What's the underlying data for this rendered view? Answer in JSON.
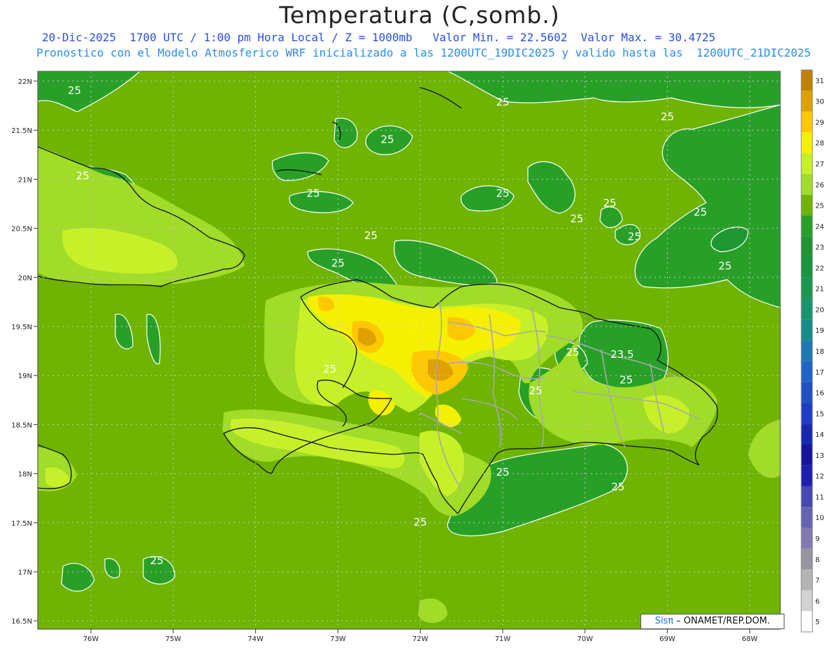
{
  "header": {
    "title": "Temperatura (C,somb.)",
    "line1": "20-Dic-2025  1700 UTC / 1:00 pm Hora Local / Z = 1000mb   Valor Min. = 22.5602  Valor Max. = 30.4725",
    "line2": "Pronostico con el Modelo Atmosferico WRF inicializado a las 1200UTC_19DIC2025 y valido hasta las  1200UTC_21DIC2025"
  },
  "axes": {
    "lat_labels": [
      "22N",
      "21.5N",
      "21N",
      "20.5N",
      "20N",
      "19.5N",
      "19N",
      "18.5N",
      "18N",
      "17.5N",
      "17N",
      "16.5N"
    ],
    "lon_labels": [
      "76W",
      "75W",
      "74W",
      "73W",
      "72W",
      "71W",
      "70W",
      "69W",
      "68W"
    ]
  },
  "colorbar": {
    "labels": [
      "31",
      "30",
      "29",
      "28",
      "27",
      "26",
      "25",
      "24",
      "23",
      "22",
      "21",
      "20",
      "19",
      "18",
      "17",
      "16",
      "15",
      "14",
      "13",
      "12",
      "11",
      "10",
      "9",
      "8",
      "7",
      "6",
      "5"
    ],
    "colors": [
      "#c08000",
      "#e0a000",
      "#ffc800",
      "#f5f000",
      "#c8f028",
      "#a0dc28",
      "#6eb400",
      "#28a028",
      "#1e9632",
      "#18963c",
      "#1a9650",
      "#16966e",
      "#148c8c",
      "#1e78b4",
      "#1e64c8",
      "#1e50c8",
      "#1e3cc8",
      "#1428b4",
      "#1414a0",
      "#1e1eb4",
      "#4646b4",
      "#6464b4",
      "#8278b4",
      "#9696a0",
      "#b4b4b4",
      "#d2d2d2",
      "#ffffff"
    ]
  },
  "contour_labels": [
    {
      "text": "25",
      "lon": -76.2,
      "lat": 21.87
    },
    {
      "text": "25",
      "lon": -76.1,
      "lat": 21.0
    },
    {
      "text": "25",
      "lon": -71.0,
      "lat": 21.75
    },
    {
      "text": "25",
      "lon": -69.0,
      "lat": 21.6
    },
    {
      "text": "25",
      "lon": -72.4,
      "lat": 21.37
    },
    {
      "text": "25",
      "lon": -73.3,
      "lat": 20.82
    },
    {
      "text": "25",
      "lon": -71.0,
      "lat": 20.82
    },
    {
      "text": "25",
      "lon": -69.7,
      "lat": 20.72
    },
    {
      "text": "25",
      "lon": -68.6,
      "lat": 20.63
    },
    {
      "text": "25",
      "lon": -70.1,
      "lat": 20.56
    },
    {
      "text": "25",
      "lon": -69.4,
      "lat": 20.38
    },
    {
      "text": "25",
      "lon": -72.6,
      "lat": 20.39
    },
    {
      "text": "25",
      "lon": -73.0,
      "lat": 20.11
    },
    {
      "text": "25",
      "lon": -68.3,
      "lat": 20.08
    },
    {
      "text": "25",
      "lon": -70.15,
      "lat": 19.2
    },
    {
      "text": "23.5",
      "lon": -69.55,
      "lat": 19.18
    },
    {
      "text": "25",
      "lon": -69.5,
      "lat": 18.92
    },
    {
      "text": "25",
      "lon": -73.1,
      "lat": 19.03
    },
    {
      "text": "25",
      "lon": -70.6,
      "lat": 18.81
    },
    {
      "text": "25",
      "lon": -71.0,
      "lat": 17.98
    },
    {
      "text": "25",
      "lon": -69.6,
      "lat": 17.83
    },
    {
      "text": "25",
      "lon": -72.0,
      "lat": 17.47
    },
    {
      "text": "25",
      "lon": -75.2,
      "lat": 17.08
    }
  ],
  "credit": {
    "sis": "Sisπ",
    "rest": " – ONAMET/REP.DOM."
  }
}
